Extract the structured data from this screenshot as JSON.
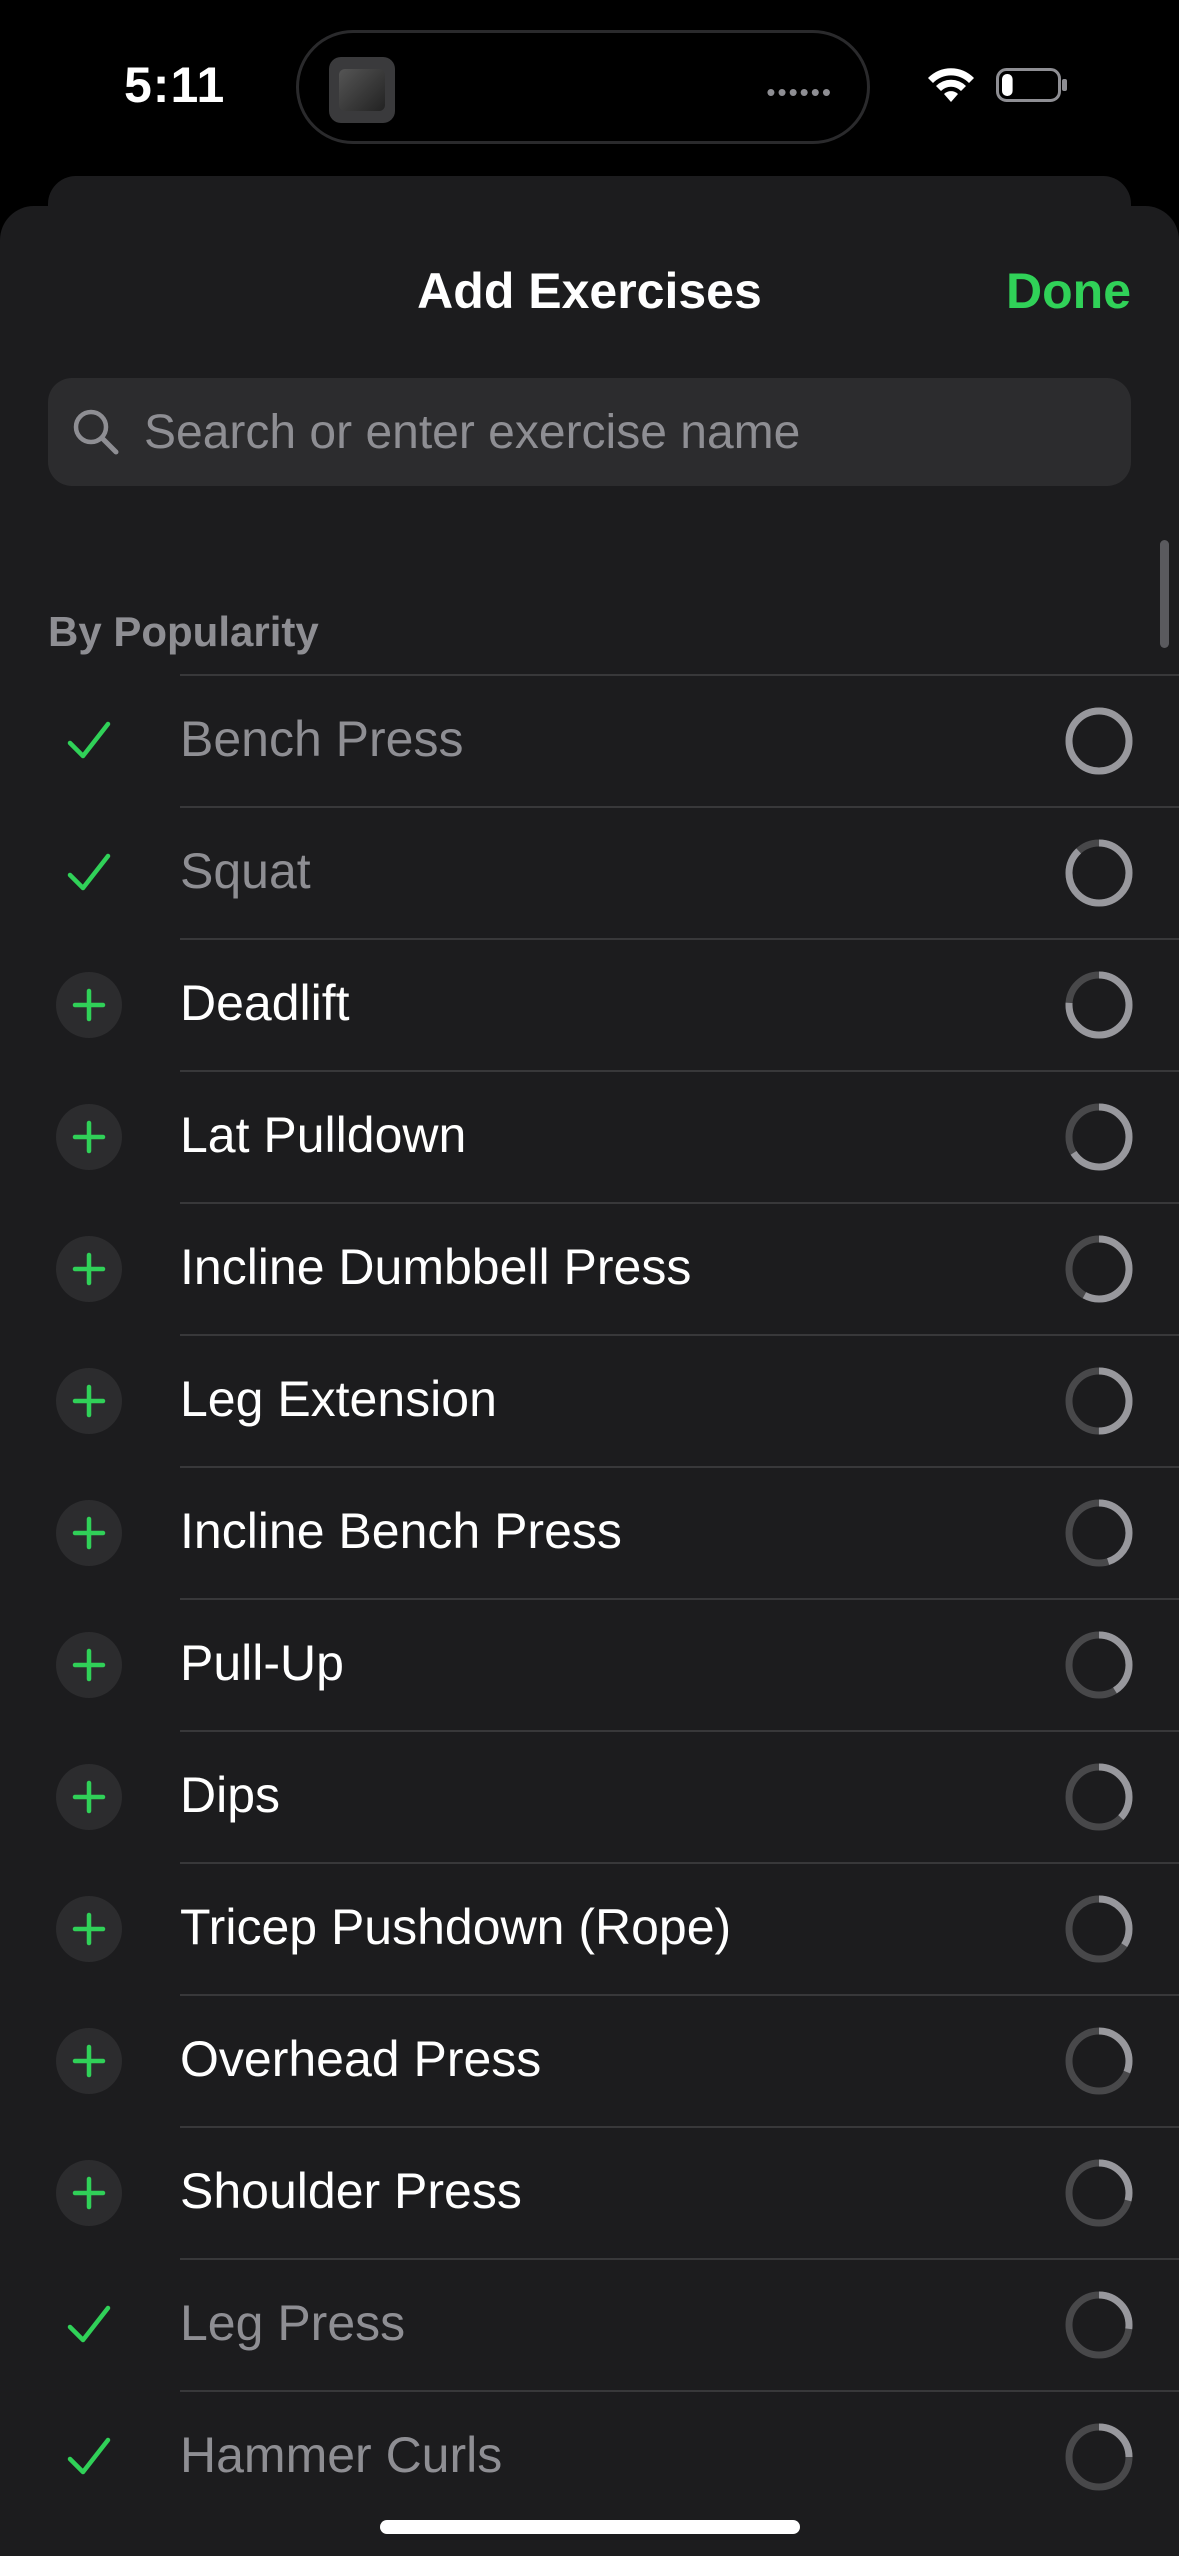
{
  "status_bar": {
    "time": "5:11",
    "battery_level": 0.2
  },
  "sheet": {
    "title": "Add Exercises",
    "done_label": "Done",
    "search_placeholder": "Search or enter exercise name",
    "section_header": "By Popularity"
  },
  "colors": {
    "accent": "#30d158",
    "background": "#1c1c1e",
    "secondary_text": "#8e8e93",
    "ring_track": "#48484a",
    "ring_fill": "#98989d"
  },
  "exercises": [
    {
      "name": "Bench Press",
      "added": true,
      "popularity": 1.0
    },
    {
      "name": "Squat",
      "added": true,
      "popularity": 0.88
    },
    {
      "name": "Deadlift",
      "added": false,
      "popularity": 0.76
    },
    {
      "name": "Lat Pulldown",
      "added": false,
      "popularity": 0.66
    },
    {
      "name": "Incline Dumbbell Press",
      "added": false,
      "popularity": 0.58
    },
    {
      "name": "Leg Extension",
      "added": false,
      "popularity": 0.5
    },
    {
      "name": "Incline Bench Press",
      "added": false,
      "popularity": 0.45
    },
    {
      "name": "Pull-Up",
      "added": false,
      "popularity": 0.41
    },
    {
      "name": "Dips",
      "added": false,
      "popularity": 0.37
    },
    {
      "name": "Tricep Pushdown (Rope)",
      "added": false,
      "popularity": 0.34
    },
    {
      "name": "Overhead Press",
      "added": false,
      "popularity": 0.31
    },
    {
      "name": "Shoulder Press",
      "added": false,
      "popularity": 0.29
    },
    {
      "name": "Leg Press",
      "added": true,
      "popularity": 0.27
    },
    {
      "name": "Hammer Curls",
      "added": true,
      "popularity": 0.25
    }
  ]
}
